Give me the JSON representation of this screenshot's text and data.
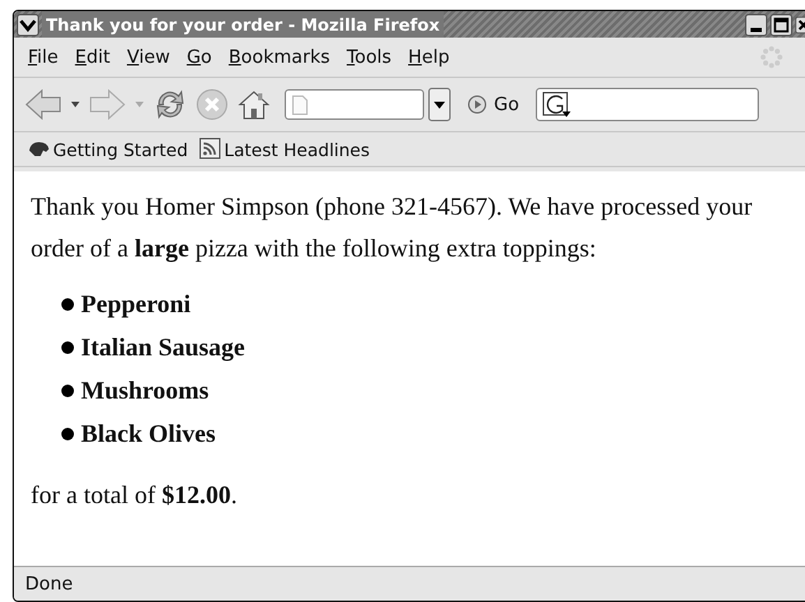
{
  "window": {
    "title": "Thank you for your order - Mozilla Firefox"
  },
  "menu": [
    "File",
    "Edit",
    "View",
    "Go",
    "Bookmarks",
    "Tools",
    "Help"
  ],
  "toolbar": {
    "go_label": "Go"
  },
  "bookmarks": [
    {
      "label": "Getting Started",
      "kind": "site"
    },
    {
      "label": "Latest Headlines",
      "kind": "feed"
    }
  ],
  "content": {
    "intro": "Thank you Homer Simpson (phone 321-4567). We have processed your order of a **large** pizza with the following extra toppings:",
    "toppings": [
      "Pepperoni",
      "Italian Sausage",
      "Mushrooms",
      "Black Olives"
    ],
    "total": "for a total of **$12.00**."
  },
  "status_bar": "Done"
}
